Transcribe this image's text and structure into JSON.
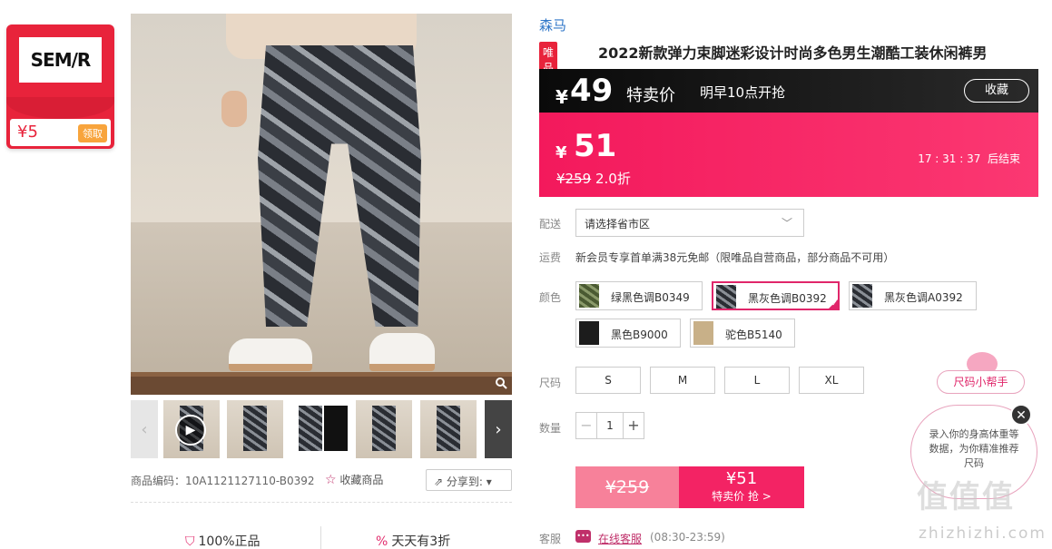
{
  "coupon": {
    "brand": "SEM/R",
    "amount": "¥5",
    "action": "领取"
  },
  "gallery": {
    "meta_code": "商品编码：10A1121127110-B0392",
    "favorite": "收藏商品",
    "share": "分享到:",
    "guarantee_1": "100%正品",
    "guarantee_2": "天天有3折"
  },
  "product": {
    "brand": "森马",
    "tag": "唯品自营",
    "title": "2022新款弹力束脚迷彩设计时尚多色男生潮酷工装休闲裤男"
  },
  "price_preview": {
    "currency": "¥",
    "price": "49",
    "label": "特卖价",
    "start": "明早10点开抢",
    "collect": "收藏"
  },
  "price_current": {
    "currency": "¥",
    "price": "51",
    "original": "¥259",
    "discount": "2.0折",
    "timer": "17 : 31 : 37",
    "timer_suffix": "后结束"
  },
  "delivery": {
    "label": "配送",
    "placeholder": "请选择省市区"
  },
  "shipping": {
    "label": "运费",
    "text": "新会员专享首单满38元免邮（限唯品自营商品，部分商品不可用）"
  },
  "colors": {
    "label": "颜色",
    "options": [
      "绿黑色调B0349",
      "黑灰色调B0392",
      "黑灰色调A0392",
      "黑色B9000",
      "驼色B5140"
    ]
  },
  "sizes": {
    "label": "尺码",
    "options": [
      "S",
      "M",
      "L",
      "XL"
    ]
  },
  "quantity": {
    "label": "数量",
    "value": "1",
    "minus": "−",
    "plus": "+"
  },
  "buy": {
    "original": "¥259",
    "price": "¥51",
    "action": "特卖价 抢 >"
  },
  "service": {
    "label": "客服",
    "link": "在线客服",
    "hours": "(08:30-23:59)"
  },
  "size_helper": {
    "button": "尺码小帮手",
    "text": "录入你的身高体重等数据，为你精准推荐尺码",
    "close": "✕"
  },
  "watermark": {
    "text": "值值值",
    "url": "zhizhizhi.com"
  }
}
